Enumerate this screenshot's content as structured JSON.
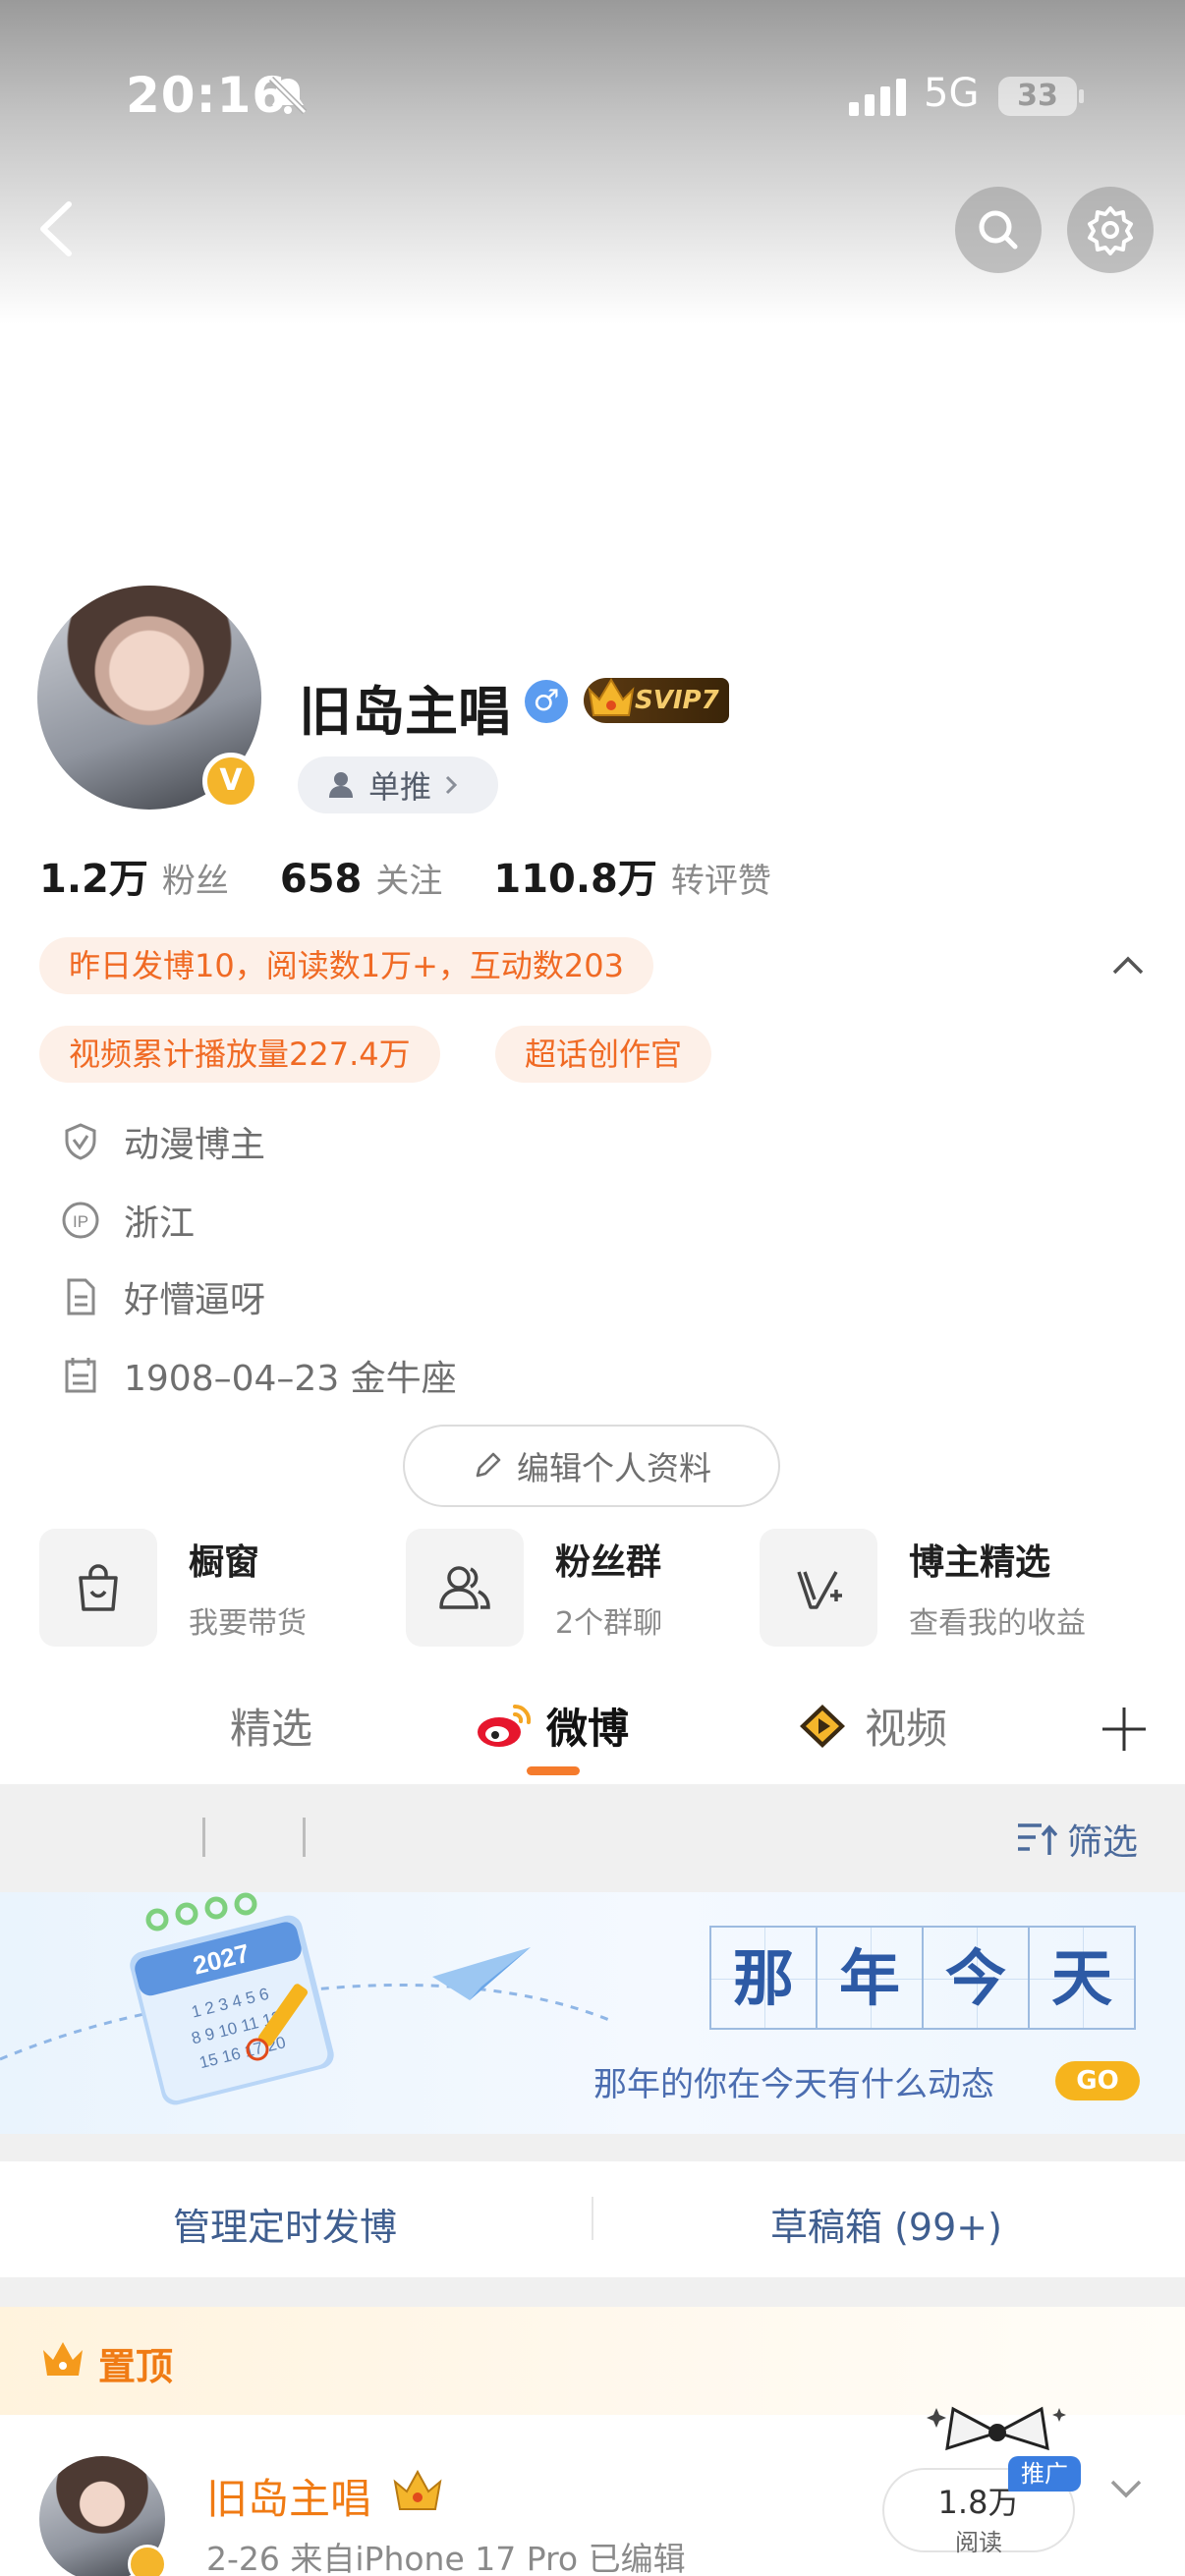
{
  "status_bar": {
    "time": "20:16",
    "network": "5G",
    "battery": "33"
  },
  "profile": {
    "username": "旧岛主唱",
    "gender_symbol": "♂",
    "vip_badge": "SVIP7",
    "verified_mark": "V",
    "pin_label": "单推",
    "stats": [
      {
        "value": "1.2万",
        "label": "粉丝"
      },
      {
        "value": "658",
        "label": "关注"
      },
      {
        "value": "110.8万",
        "label": "转评赞"
      }
    ],
    "chips": [
      "昨日发博10，阅读数1万+，互动数203",
      "视频累计播放量227.4万",
      "超话创作官"
    ],
    "info": [
      {
        "icon": "shield-icon",
        "text": "动漫博主"
      },
      {
        "icon": "ip-icon",
        "text": "浙江"
      },
      {
        "icon": "document-icon",
        "text": "好懵逼呀"
      },
      {
        "icon": "calendar-icon",
        "text": "1908–04–23 金牛座"
      }
    ],
    "edit_label": "编辑个人资料"
  },
  "tiles": [
    {
      "title": "橱窗",
      "subtitle": "我要带货",
      "icon": "shopping-bag-icon"
    },
    {
      "title": "粉丝群",
      "subtitle": "2个群聊",
      "icon": "group-icon"
    },
    {
      "title": "博主精选",
      "subtitle": "查看我的收益",
      "icon": "selection-icon"
    }
  ],
  "tabs": [
    {
      "label": "精选",
      "active": false
    },
    {
      "label": "微博",
      "active": true
    },
    {
      "label": "视频",
      "active": false
    }
  ],
  "filter": {
    "label": "筛选"
  },
  "banner": {
    "title_chars": [
      "那",
      "年",
      "今",
      "天"
    ],
    "subtitle": "那年的你在今天有什么动态",
    "go_label": "GO",
    "calendar_year": "2027"
  },
  "actions": {
    "scheduled": "管理定时发博",
    "drafts": "草稿箱 (99+)"
  },
  "pinned": {
    "label": "置顶",
    "post": {
      "author": "旧岛主唱",
      "meta": "2-26  来自iPhone 17 Pro  已编辑",
      "read_count": "1.8万",
      "read_label": "阅读",
      "promo": "推广"
    }
  },
  "colors": {
    "accent": "#f57b2c",
    "chip_text": "#f06a24",
    "link_blue": "#3f5e8f",
    "vip_gold": "#f4b52b"
  }
}
